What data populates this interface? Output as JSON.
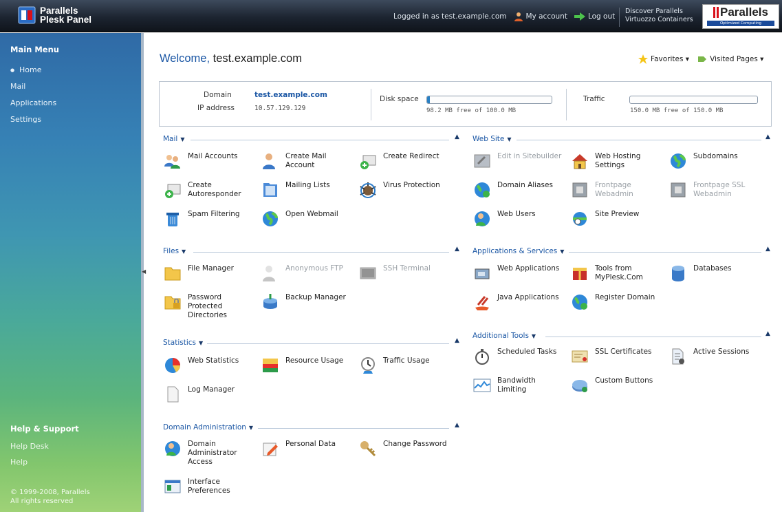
{
  "header": {
    "logo": {
      "line1": "Parallels",
      "line2": "Plesk Panel"
    },
    "logged_in": "Logged in as test.example.com",
    "my_account": "My account",
    "log_out": "Log out",
    "discover": {
      "line1": "Discover Parallels",
      "line2": "Virtuozzo Containers"
    },
    "brand": {
      "name": "Parallels",
      "tagline": "Optimized Computing"
    }
  },
  "sidebar": {
    "title": "Main Menu",
    "items": [
      {
        "label": "Home"
      },
      {
        "label": "Mail"
      },
      {
        "label": "Applications"
      },
      {
        "label": "Settings"
      }
    ],
    "help_title": "Help & Support",
    "help_desk": "Help Desk",
    "help": "Help",
    "copyright_1": "© 1999-2008, Parallels",
    "copyright_2": "All rights reserved"
  },
  "main": {
    "welcome_prefix": "Welcome,",
    "welcome_domain": "test.example.com",
    "favorites": "Favorites",
    "visited_pages": "Visited Pages",
    "info": {
      "domain_label": "Domain",
      "domain_value": "test.example.com",
      "ip_label": "IP address",
      "ip_value": "10.57.129.129",
      "disk_label": "Disk space",
      "disk_used_fraction": 0.02,
      "disk_text": "98.2 MB free of 100.0 MB",
      "traffic_label": "Traffic",
      "traffic_used_fraction": 0.0,
      "traffic_text": "150.0 MB free of 150.0 MB"
    },
    "sections": {
      "mail": {
        "title": "Mail",
        "buttons": [
          "Mail Accounts",
          "Create Mail Account",
          "Create Redirect",
          "Create Autoresponder",
          "Mailing Lists",
          "Virus Protection",
          "Spam Filtering",
          "Open Webmail"
        ]
      },
      "files": {
        "title": "Files",
        "buttons": [
          "File Manager",
          "Anonymous FTP",
          "SSH Terminal",
          "Password Protected Directories",
          "Backup Manager"
        ]
      },
      "statistics": {
        "title": "Statistics",
        "buttons": [
          "Web Statistics",
          "Resource Usage",
          "Traffic Usage",
          "Log Manager"
        ]
      },
      "domain_admin": {
        "title": "Domain Administration",
        "buttons": [
          "Domain Administrator Access",
          "Personal Data",
          "Change Password",
          "Interface Preferences"
        ]
      },
      "website": {
        "title": "Web Site",
        "buttons": [
          "Edit in Sitebuilder",
          "Web Hosting Settings",
          "Subdomains",
          "Domain Aliases",
          "Frontpage Webadmin",
          "Frontpage SSL Webadmin",
          "Web Users",
          "Site Preview"
        ]
      },
      "apps": {
        "title": "Applications & Services",
        "buttons": [
          "Web Applications",
          "Tools from MyPlesk.Com",
          "Databases",
          "Java Applications",
          "Register Domain"
        ]
      },
      "tools": {
        "title": "Additional Tools",
        "buttons": [
          "Scheduled Tasks",
          "SSL Certificates",
          "Active Sessions",
          "Bandwidth Limiting",
          "Custom Buttons"
        ]
      }
    }
  }
}
